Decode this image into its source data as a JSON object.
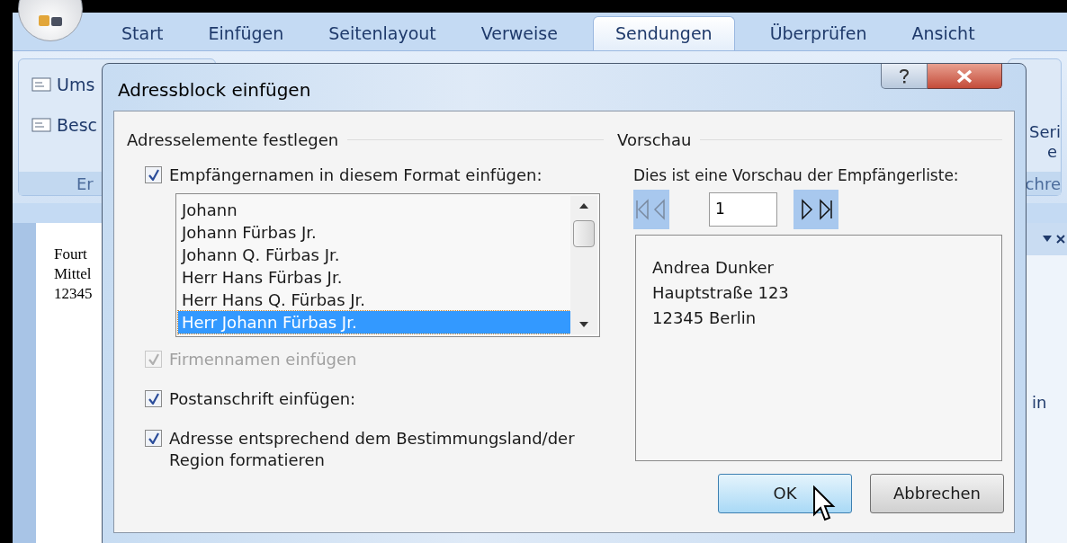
{
  "ribbon": {
    "tabs": [
      {
        "label": "Start",
        "selected": false
      },
      {
        "label": "Einfügen",
        "selected": false
      },
      {
        "label": "Seitenlayout",
        "selected": false
      },
      {
        "label": "Verweise",
        "selected": false
      },
      {
        "label": "Sendungen",
        "selected": true
      },
      {
        "label": "Überprüfen",
        "selected": false
      },
      {
        "label": "Ansicht",
        "selected": false
      }
    ],
    "left_group": {
      "items": [
        "Ums",
        "Besc"
      ],
      "label": "Er"
    },
    "right_group": {
      "lines": [
        "Seri",
        "e"
      ],
      "label": "chre"
    }
  },
  "document": {
    "lines": [
      "Fourt",
      "Mittel",
      "12345"
    ]
  },
  "side_pane": {
    "text": "in"
  },
  "dialog": {
    "title": "Adressblock einfügen",
    "left_section": {
      "title": "Adresselemente festlegen",
      "name_option": {
        "label": "Empfängernamen in diesem Format einfügen:",
        "checked": true,
        "disabled": false
      },
      "name_formats": [
        {
          "label": "Johann",
          "selected": false
        },
        {
          "label": "Johann Fürbas Jr.",
          "selected": false
        },
        {
          "label": "Johann Q. Fürbas Jr.",
          "selected": false
        },
        {
          "label": "Herr Hans Fürbas Jr.",
          "selected": false
        },
        {
          "label": "Herr Hans Q. Fürbas Jr.",
          "selected": false
        },
        {
          "label": "Herr Johann Fürbas Jr.",
          "selected": true
        }
      ],
      "options": [
        {
          "label": "Firmennamen einfügen",
          "checked": true,
          "disabled": true
        },
        {
          "label": "Postanschrift einfügen:",
          "checked": true,
          "disabled": false
        },
        {
          "label": "Adresse entsprechend dem Bestimmungsland/der Region formatieren",
          "checked": true,
          "disabled": false
        }
      ]
    },
    "preview": {
      "title": "Vorschau",
      "caption": "Dies ist eine Vorschau der Empfängerliste:",
      "record": "1",
      "address_lines": [
        "Andrea Dunker",
        "Hauptstraße 123",
        "12345 Berlin"
      ]
    },
    "buttons": [
      {
        "label": "OK",
        "kind": "default"
      },
      {
        "label": "Abbrechen",
        "kind": "normal"
      }
    ]
  }
}
